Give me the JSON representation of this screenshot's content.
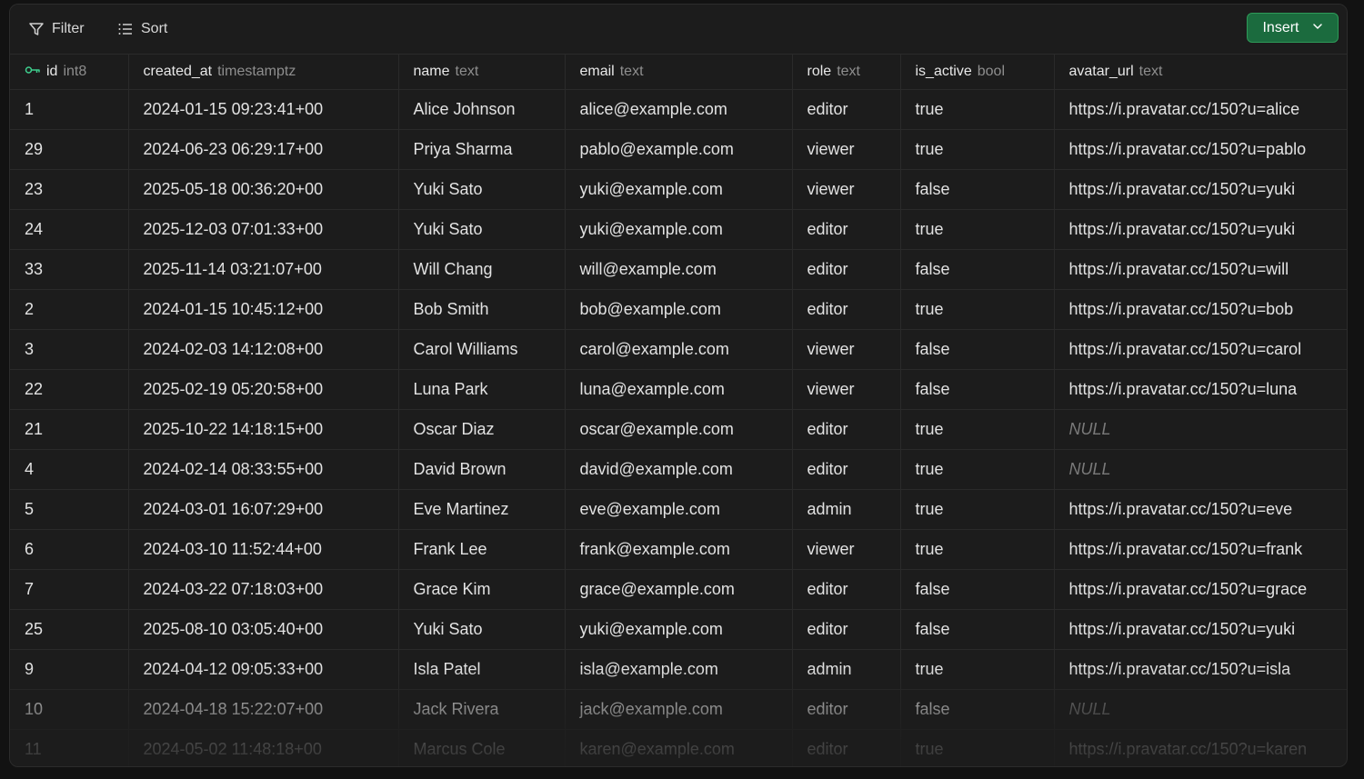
{
  "toolbar": {
    "filter_label": "Filter",
    "sort_label": "Sort",
    "insert_label": "Insert"
  },
  "columns": [
    {
      "name": "id",
      "type": "int8",
      "primary_key": true
    },
    {
      "name": "created_at",
      "type": "timestamptz"
    },
    {
      "name": "name",
      "type": "text"
    },
    {
      "name": "email",
      "type": "text"
    },
    {
      "name": "role",
      "type": "text"
    },
    {
      "name": "is_active",
      "type": "bool"
    },
    {
      "name": "avatar_url",
      "type": "text"
    }
  ],
  "rows": [
    [
      "1",
      "2024-01-15 09:23:41+00",
      "Alice Johnson",
      "alice@example.com",
      "editor",
      "true",
      "https://i.pravatar.cc/150?u=alice"
    ],
    [
      "29",
      "2024-06-23 06:29:17+00",
      "Priya Sharma",
      "pablo@example.com",
      "viewer",
      "true",
      "https://i.pravatar.cc/150?u=pablo"
    ],
    [
      "23",
      "2025-05-18 00:36:20+00",
      "Yuki Sato",
      "yuki@example.com",
      "viewer",
      "false",
      "https://i.pravatar.cc/150?u=yuki"
    ],
    [
      "24",
      "2025-12-03 07:01:33+00",
      "Yuki Sato",
      "yuki@example.com",
      "editor",
      "true",
      "https://i.pravatar.cc/150?u=yuki"
    ],
    [
      "33",
      "2025-11-14 03:21:07+00",
      "Will Chang",
      "will@example.com",
      "editor",
      "false",
      "https://i.pravatar.cc/150?u=will"
    ],
    [
      "2",
      "2024-01-15 10:45:12+00",
      "Bob Smith",
      "bob@example.com",
      "editor",
      "true",
      "https://i.pravatar.cc/150?u=bob"
    ],
    [
      "3",
      "2024-02-03 14:12:08+00",
      "Carol Williams",
      "carol@example.com",
      "viewer",
      "false",
      "https://i.pravatar.cc/150?u=carol"
    ],
    [
      "22",
      "2025-02-19 05:20:58+00",
      "Luna Park",
      "luna@example.com",
      "viewer",
      "false",
      "https://i.pravatar.cc/150?u=luna"
    ],
    [
      "21",
      "2025-10-22 14:18:15+00",
      "Oscar Diaz",
      "oscar@example.com",
      "editor",
      "true",
      "NULL"
    ],
    [
      "4",
      "2024-02-14 08:33:55+00",
      "David Brown",
      "david@example.com",
      "editor",
      "true",
      "NULL"
    ],
    [
      "5",
      "2024-03-01 16:07:29+00",
      "Eve Martinez",
      "eve@example.com",
      "admin",
      "true",
      "https://i.pravatar.cc/150?u=eve"
    ],
    [
      "6",
      "2024-03-10 11:52:44+00",
      "Frank Lee",
      "frank@example.com",
      "viewer",
      "true",
      "https://i.pravatar.cc/150?u=frank"
    ],
    [
      "7",
      "2024-03-22 07:18:03+00",
      "Grace Kim",
      "grace@example.com",
      "editor",
      "false",
      "https://i.pravatar.cc/150?u=grace"
    ],
    [
      "25",
      "2025-08-10 03:05:40+00",
      "Yuki Sato",
      "yuki@example.com",
      "editor",
      "false",
      "https://i.pravatar.cc/150?u=yuki"
    ],
    [
      "9",
      "2024-04-12 09:05:33+00",
      "Isla Patel",
      "isla@example.com",
      "admin",
      "true",
      "https://i.pravatar.cc/150?u=isla"
    ],
    [
      "10",
      "2024-04-18 15:22:07+00",
      "Jack Rivera",
      "jack@example.com",
      "editor",
      "false",
      "NULL"
    ],
    [
      "11",
      "2024-05-02 11:48:18+00",
      "Marcus Cole",
      "karen@example.com",
      "editor",
      "true",
      "https://i.pravatar.cc/150?u=karen"
    ]
  ],
  "colors": {
    "insert_bg": "#1b6b3e",
    "insert_border": "#2e9a58",
    "key_icon": "#3ecf8e"
  }
}
